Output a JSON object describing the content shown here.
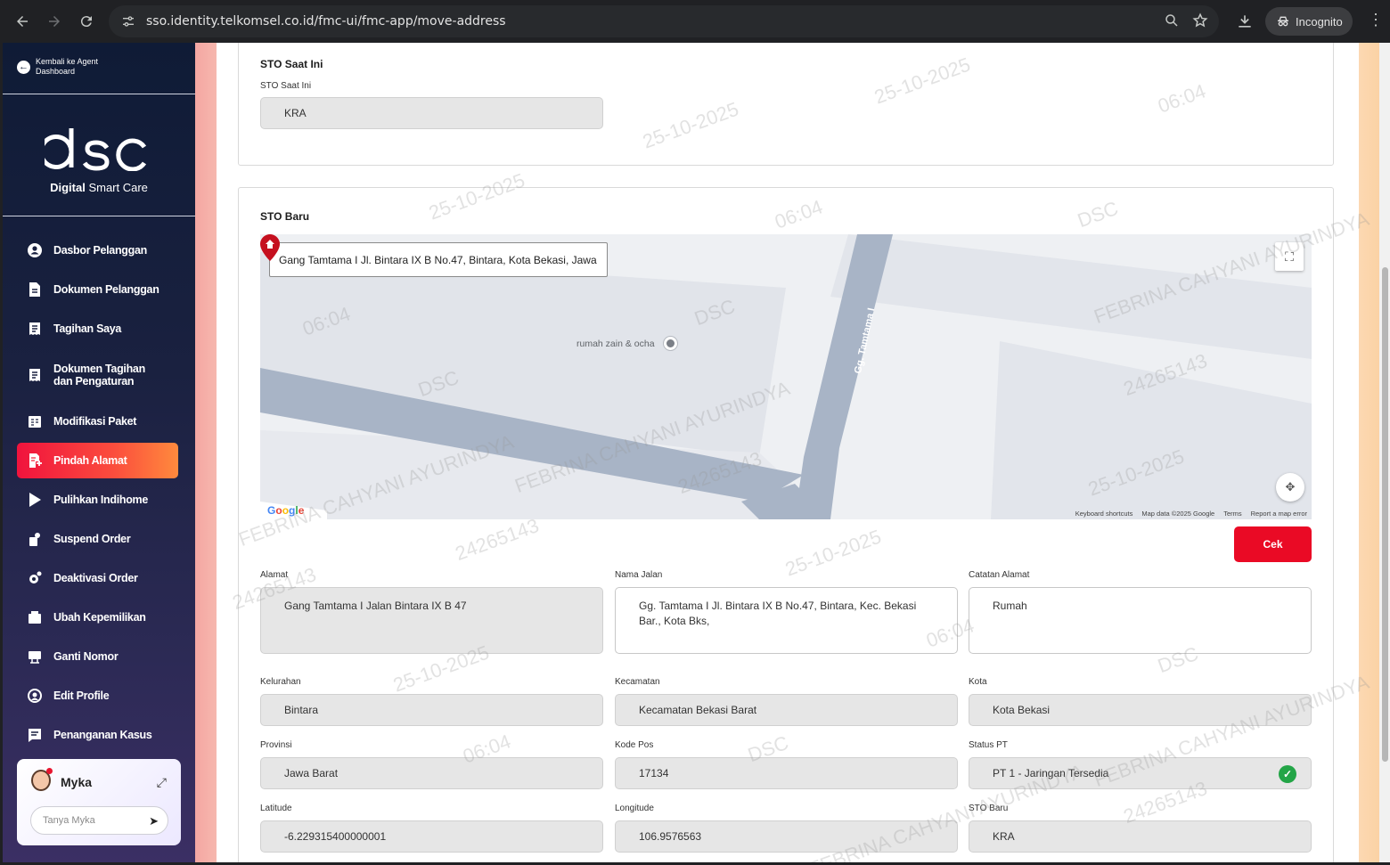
{
  "browser": {
    "url": "sso.identity.telkomsel.co.id/fmc-ui/fmc-app/move-address",
    "incognito_label": "Incognito"
  },
  "sidebar": {
    "back_label_line1": "Kembali ke Agent",
    "back_label_line2": "Dashboard",
    "brand_bold": "Digital",
    "brand_rest": " Smart Care",
    "items": [
      {
        "label": "Dasbor Pelanggan",
        "icon": "user-circle-icon"
      },
      {
        "label": "Dokumen Pelanggan",
        "icon": "document-icon"
      },
      {
        "label": "Tagihan Saya",
        "icon": "bill-icon"
      },
      {
        "label_line1": "Dokumen Tagihan",
        "label_line2": "dan Pengaturan",
        "icon": "bill-settings-icon"
      },
      {
        "label": "Modifikasi Paket",
        "icon": "package-edit-icon"
      },
      {
        "label": "Pindah Alamat",
        "icon": "move-address-icon",
        "active": true
      },
      {
        "label": "Pulihkan Indihome",
        "icon": "play-icon"
      },
      {
        "label": "Suspend Order",
        "icon": "suspend-icon"
      },
      {
        "label": "Deaktivasi Order",
        "icon": "gear-off-icon"
      },
      {
        "label": "Ubah Kepemilikan",
        "icon": "ownership-icon"
      },
      {
        "label": "Ganti Nomor",
        "icon": "sim-icon"
      },
      {
        "label": "Edit Profile",
        "icon": "profile-edit-icon"
      },
      {
        "label": "Penanganan Kasus",
        "icon": "case-icon"
      }
    ],
    "myka": {
      "name": "Myka",
      "placeholder": "Tanya Myka"
    }
  },
  "sto_current": {
    "title": "STO Saat Ini",
    "label": "STO Saat Ini",
    "value": "KRA"
  },
  "sto_new": {
    "title": "STO Baru",
    "map": {
      "search_value": "Gang Tamtama I Jl. Bintara IX B No.47, Bintara, Kota Bekasi, Jawa",
      "poi_label": "rumah zain & ocha",
      "road_label": "Gg. Tamtama I",
      "google": "Google",
      "attribution": [
        "Keyboard shortcuts",
        "Map data ©2025 Google",
        "Terms",
        "Report a map error"
      ]
    },
    "cek_button": "Cek",
    "fields": {
      "alamat": {
        "label": "Alamat",
        "value": "Gang Tamtama I Jalan Bintara IX B 47"
      },
      "nama_jalan": {
        "label": "Nama Jalan",
        "value": "Gg. Tamtama I Jl. Bintara IX B No.47, Bintara, Kec. Bekasi Bar., Kota Bks,"
      },
      "catatan_alamat": {
        "label": "Catatan Alamat",
        "value": "Rumah"
      },
      "kelurahan": {
        "label": "Kelurahan",
        "value": "Bintara"
      },
      "kecamatan": {
        "label": "Kecamatan",
        "value": "Kecamatan Bekasi Barat"
      },
      "kota": {
        "label": "Kota",
        "value": "Kota Bekasi"
      },
      "provinsi": {
        "label": "Provinsi",
        "value": "Jawa Barat"
      },
      "kode_pos": {
        "label": "Kode Pos",
        "value": "17134"
      },
      "status_pt": {
        "label": "Status PT",
        "value": "PT 1 - Jaringan Tersedia"
      },
      "latitude": {
        "label": "Latitude",
        "value": "-6.229315400000001"
      },
      "longitude": {
        "label": "Longitude",
        "value": "106.9576563"
      },
      "sto_baru": {
        "label": "STO Baru",
        "value": "KRA"
      }
    }
  },
  "watermark": {
    "name": "FEBRINA CAHYANI AYURINDYA",
    "id": "24265143",
    "brand": "DSC",
    "time": "06:04",
    "date": "25-10-2025"
  },
  "colors": {
    "accent": "#ea0a25",
    "sidebar": "#0f1b36",
    "success": "#23a547"
  }
}
